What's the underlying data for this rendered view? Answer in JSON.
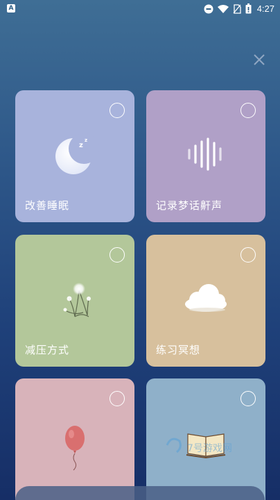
{
  "status_bar": {
    "app_badge": "A",
    "time": "4:27",
    "icons": [
      "dnd-icon",
      "wifi-icon",
      "no-sim-icon",
      "battery-icon"
    ]
  },
  "close": {
    "icon": "close-icon"
  },
  "cards": [
    {
      "label": "改善睡眠",
      "icon": "moon-sleep-icon",
      "color": "#a8b3dc",
      "selected": false
    },
    {
      "label": "记录梦话鼾声",
      "icon": "sound-wave-icon",
      "color": "#b0a0c7",
      "selected": false
    },
    {
      "label": "减压方式",
      "icon": "dandelion-icon",
      "color": "#b3c79a",
      "selected": false
    },
    {
      "label": "练习冥想",
      "icon": "cloud-icon",
      "color": "#d7c09d",
      "selected": false
    },
    {
      "label": "",
      "icon": "balloon-icon",
      "color": "#d8b3ba",
      "selected": false
    },
    {
      "label": "",
      "icon": "book-icon",
      "color": "#8fb0c9",
      "selected": false
    }
  ],
  "watermark": {
    "text": "7号游戏网"
  }
}
